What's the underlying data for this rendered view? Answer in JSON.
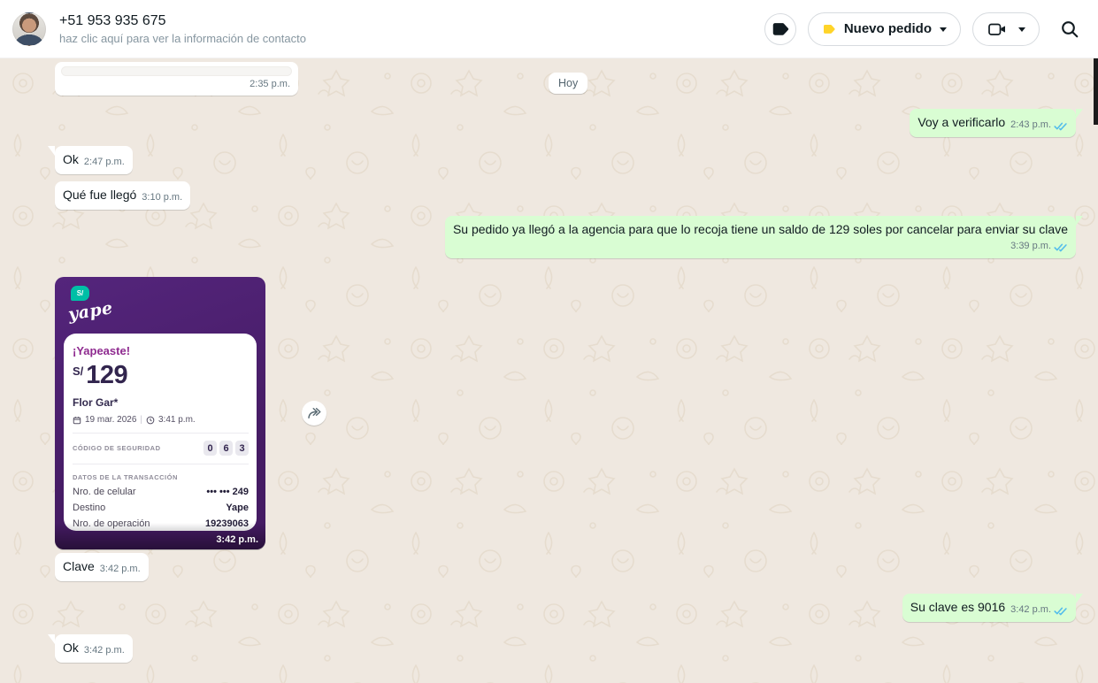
{
  "theme": {
    "chat_bg": "#efe8e0",
    "doodle": "#e3d8c9",
    "header_bg": "#ffffff",
    "incoming_bubble": "#ffffff",
    "outgoing_bubble": "#d9fdd3",
    "text": "#111b21",
    "time": "#667781",
    "check_blue": "#53bdeb",
    "label_yellow": "#ffd429",
    "label_black": "#111b21",
    "yape_teal": "#00bfa6",
    "yape_magenta": "#8f2b90",
    "yape_ink": "#32254e"
  },
  "header": {
    "title": "+51 953 935 675",
    "subtitle": "haz clic aquí para ver la información de contacto",
    "new_order_label": "Nuevo pedido"
  },
  "chat": {
    "date_divider": "Hoy",
    "messages": [
      {
        "direction": "in",
        "text": "",
        "time": "2:35 p.m."
      },
      {
        "direction": "out",
        "text": "Voy a verificarlo",
        "time": "2:43 p.m.",
        "status": "read"
      },
      {
        "direction": "in",
        "text": "Ok",
        "time": "2:47 p.m."
      },
      {
        "direction": "in",
        "text": "Qué fue llegó",
        "time": "3:10 p.m."
      },
      {
        "direction": "out",
        "text": "Su pedido ya llegó a la agencia para que lo recoja tiene un saldo de 129 soles por cancelar para enviar su clave",
        "time": "3:39 p.m.",
        "status": "read"
      },
      {
        "direction": "in",
        "text": "[imagen: comprobante Yape]",
        "time": "3:42 p.m."
      },
      {
        "direction": "in",
        "text": "Clave",
        "time": "3:42 p.m."
      },
      {
        "direction": "out",
        "text": "Su clave es 9016",
        "time": "3:42 p.m.",
        "status": "read"
      },
      {
        "direction": "in",
        "text": "Ok",
        "time": "3:42 p.m."
      }
    ]
  },
  "yape": {
    "brand": "yape",
    "badge": "S/",
    "title": "¡Yapeaste!",
    "currency": "S/",
    "amount": "129",
    "recipient": "Flor Gar*",
    "date": "19 mar. 2026",
    "time": "3:41 p.m.",
    "date_separator": "|",
    "security_code_label": "CÓDIGO DE SEGURIDAD",
    "security_code": [
      "0",
      "6",
      "3"
    ],
    "transaction_label": "DATOS DE LA TRANSACCIÓN",
    "rows": [
      {
        "label": "Nro. de celular",
        "value": "••• ••• 249"
      },
      {
        "label": "Destino",
        "value": "Yape"
      },
      {
        "label": "Nro. de operación",
        "value": "19239063"
      }
    ],
    "timestamp": "3:42 p.m."
  }
}
